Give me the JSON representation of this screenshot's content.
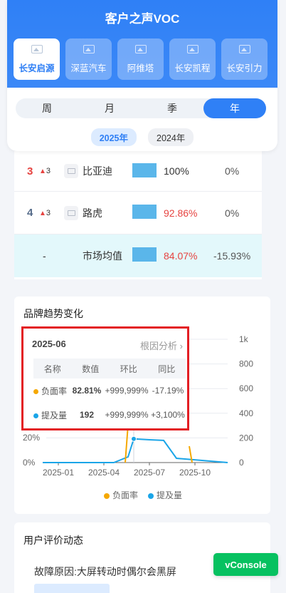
{
  "app": {
    "title": "客户之声VOC"
  },
  "brand_tabs": [
    {
      "label": "长安启源",
      "active": true
    },
    {
      "label": "深蓝汽车",
      "active": false
    },
    {
      "label": "阿维塔",
      "active": false
    },
    {
      "label": "长安凯程",
      "active": false
    },
    {
      "label": "长安引力",
      "active": false
    }
  ],
  "period_tabs": [
    {
      "label": "周",
      "active": false
    },
    {
      "label": "月",
      "active": false
    },
    {
      "label": "季",
      "active": false
    },
    {
      "label": "年",
      "active": true
    }
  ],
  "years": [
    {
      "label": "2025年",
      "active": true
    },
    {
      "label": "2024年",
      "active": false
    }
  ],
  "ranking": [
    {
      "rank": "3",
      "trend": "3",
      "name": "比亚迪",
      "bar_pct": 0.53,
      "pct": "100%",
      "change": "0%",
      "rank_color": "#e64340",
      "pct_color": "#333333"
    },
    {
      "rank": "4",
      "trend": "3",
      "name": "路虎",
      "bar_pct": 0.53,
      "pct": "92.86%",
      "change": "0%",
      "rank_color": "#556b8a",
      "pct_color": "#e64340"
    }
  ],
  "market": {
    "rank": "-",
    "name": "市场均值",
    "bar_pct": 0.53,
    "pct": "84.07%",
    "change": "-15.93%",
    "pct_color": "#e64340"
  },
  "trend": {
    "title": "品牌趋势变化",
    "legend": [
      {
        "name": "负面率",
        "color": "#f5a800"
      },
      {
        "name": "提及量",
        "color": "#1aa5e8"
      }
    ]
  },
  "chart_data": {
    "type": "line",
    "x_ticks": [
      "2025-01",
      "2025-04",
      "2025-07",
      "2025-10"
    ],
    "y_left_ticks": [
      "0%",
      "20%"
    ],
    "y_right_ticks": [
      "0",
      "200",
      "400",
      "600",
      "800",
      "1k"
    ],
    "ylim_right": [
      0,
      1000
    ],
    "series": [
      {
        "name": "负面率",
        "axis": "left",
        "color": "#f5a800",
        "x": [
          "2025-01",
          "2025-02",
          "2025-03",
          "2025-04",
          "2025-05",
          "2025-06",
          "2025-07",
          "2025-08",
          "2025-09",
          "2025-10",
          "2025-11"
        ],
        "values": [
          0,
          0,
          0,
          0,
          0,
          82.81,
          100,
          100,
          100,
          100,
          0
        ]
      },
      {
        "name": "提及量",
        "axis": "right",
        "color": "#1aa5e8",
        "x": [
          "2025-01",
          "2025-02",
          "2025-03",
          "2025-04",
          "2025-05",
          "2025-06",
          "2025-07",
          "2025-08",
          "2025-09",
          "2025-10",
          "2025-11"
        ],
        "values": [
          0,
          0,
          0,
          0,
          0,
          192,
          185,
          180,
          0,
          0,
          0
        ]
      }
    ]
  },
  "tooltip": {
    "date": "2025-06",
    "link": "根因分析",
    "headers": [
      "名称",
      "数值",
      "环比",
      "同比"
    ],
    "rows": [
      {
        "name": "负面率",
        "value": "82.81%",
        "mom": "+999,999%",
        "yoy": "-17.19%",
        "color": "#f5a800"
      },
      {
        "name": "提及量",
        "value": "192",
        "mom": "+999,999%",
        "yoy": "+3,100%",
        "color": "#1aa5e8"
      }
    ]
  },
  "reviews": {
    "title": "用户评价动态",
    "first": "故障原因:大屏转动时偶尔会黑屏"
  },
  "vconsole": "vConsole"
}
